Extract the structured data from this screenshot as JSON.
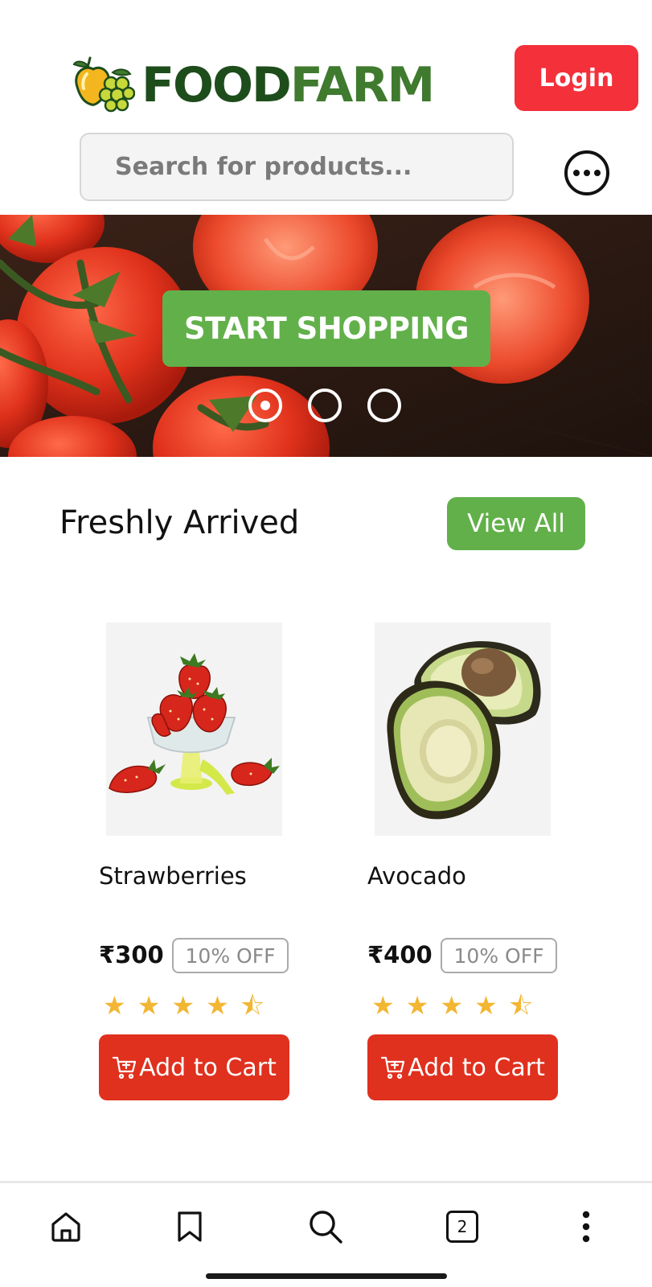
{
  "header": {
    "brand_part1": "FOOD",
    "brand_part2": "FARM",
    "login_label": "Login"
  },
  "search": {
    "placeholder": "Search for products..."
  },
  "banner": {
    "cta_label": "START SHOPPING",
    "slides": 3,
    "active_slide": 1
  },
  "section": {
    "title": "Freshly Arrived",
    "view_all_label": "View All"
  },
  "products": [
    {
      "name": "Strawberries",
      "price": "₹300",
      "discount": "10% OFF",
      "rating": 4.5,
      "cart_label": "Add to Cart"
    },
    {
      "name": "Avocado",
      "price": "₹400",
      "discount": "10% OFF",
      "rating": 4.5,
      "cart_label": "Add to Cart"
    }
  ],
  "bottom_nav": {
    "items": [
      "home-icon",
      "bookmark-icon",
      "search-icon",
      "tabs-icon",
      "more-vertical-icon"
    ],
    "tab_count": "2"
  },
  "colors": {
    "brand_dark_green": "#1e4d1c",
    "brand_green": "#3f7a2e",
    "accent_green": "#62b04a",
    "login_red": "#f4303b",
    "cart_red": "#e0301e",
    "star_yellow": "#f2b632"
  }
}
